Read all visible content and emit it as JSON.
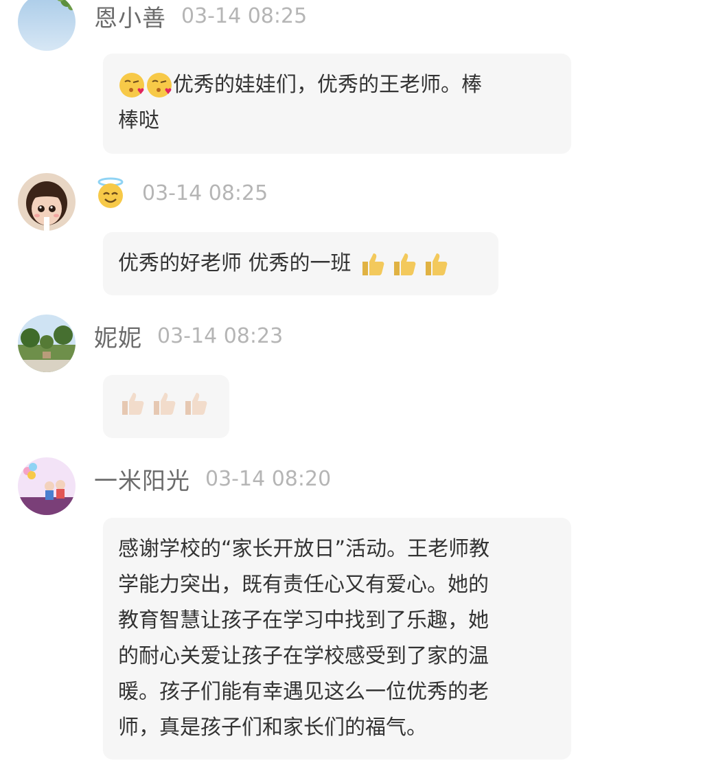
{
  "comments": [
    {
      "name": "恩小善",
      "time": "03-14 08:25",
      "avatar": "avatar-sky-tree",
      "text": "优秀的娃娃们，优秀的王老师。棒棒哒",
      "line1": "优秀的娃娃们，优秀的王老师。棒",
      "line2": "棒哒",
      "leading_emojis": [
        "kissing-heart-emoji",
        "kissing-heart-emoji"
      ]
    },
    {
      "name": "",
      "name_emoji": "smiling-face-with-halo-emoji",
      "time": "03-14 08:25",
      "avatar": "avatar-cartoon-girl",
      "text": "优秀的好老师 优秀的一班",
      "trailing_emojis": [
        "thumbs-up-emoji",
        "thumbs-up-emoji",
        "thumbs-up-emoji"
      ]
    },
    {
      "name": "妮妮",
      "time": "03-14 08:23",
      "avatar": "avatar-garden",
      "text": "",
      "emojis": [
        "thumbs-up-light-emoji",
        "thumbs-up-light-emoji",
        "thumbs-up-light-emoji"
      ]
    },
    {
      "name": "一米阳光",
      "time": "03-14 08:20",
      "avatar": "avatar-kids-balloons",
      "text": "感谢学校的“家长开放日”活动。王老师教学能力突出，既有责任心又有爱心。她的教育智慧让孩子在学习中找到了乐趣，她的耐心关爱让孩子在学校感受到了家的温暖。孩子们能有幸遇见这么一位优秀的老师，真是孩子们和家长们的福气。",
      "lines": [
        "感谢学校的“家长开放日”活动。王老师教",
        "学能力突出，既有责任心又有爱心。她的",
        "教育智慧让孩子在学习中找到了乐趣，她",
        "的耐心关爱让孩子在学校感受到了家的温",
        "暖。孩子们能有幸遇见这么一位优秀的老",
        "师，真是孩子们和家长们的福气。"
      ]
    }
  ],
  "colors": {
    "name": "#6b6b6b",
    "time": "#b5b5b5",
    "bubble_bg": "#f6f6f6",
    "text": "#333333",
    "emoji_yellow": "#f7c948",
    "thumb_yellow": "#f3c95c",
    "thumb_light": "#f2dccb"
  }
}
